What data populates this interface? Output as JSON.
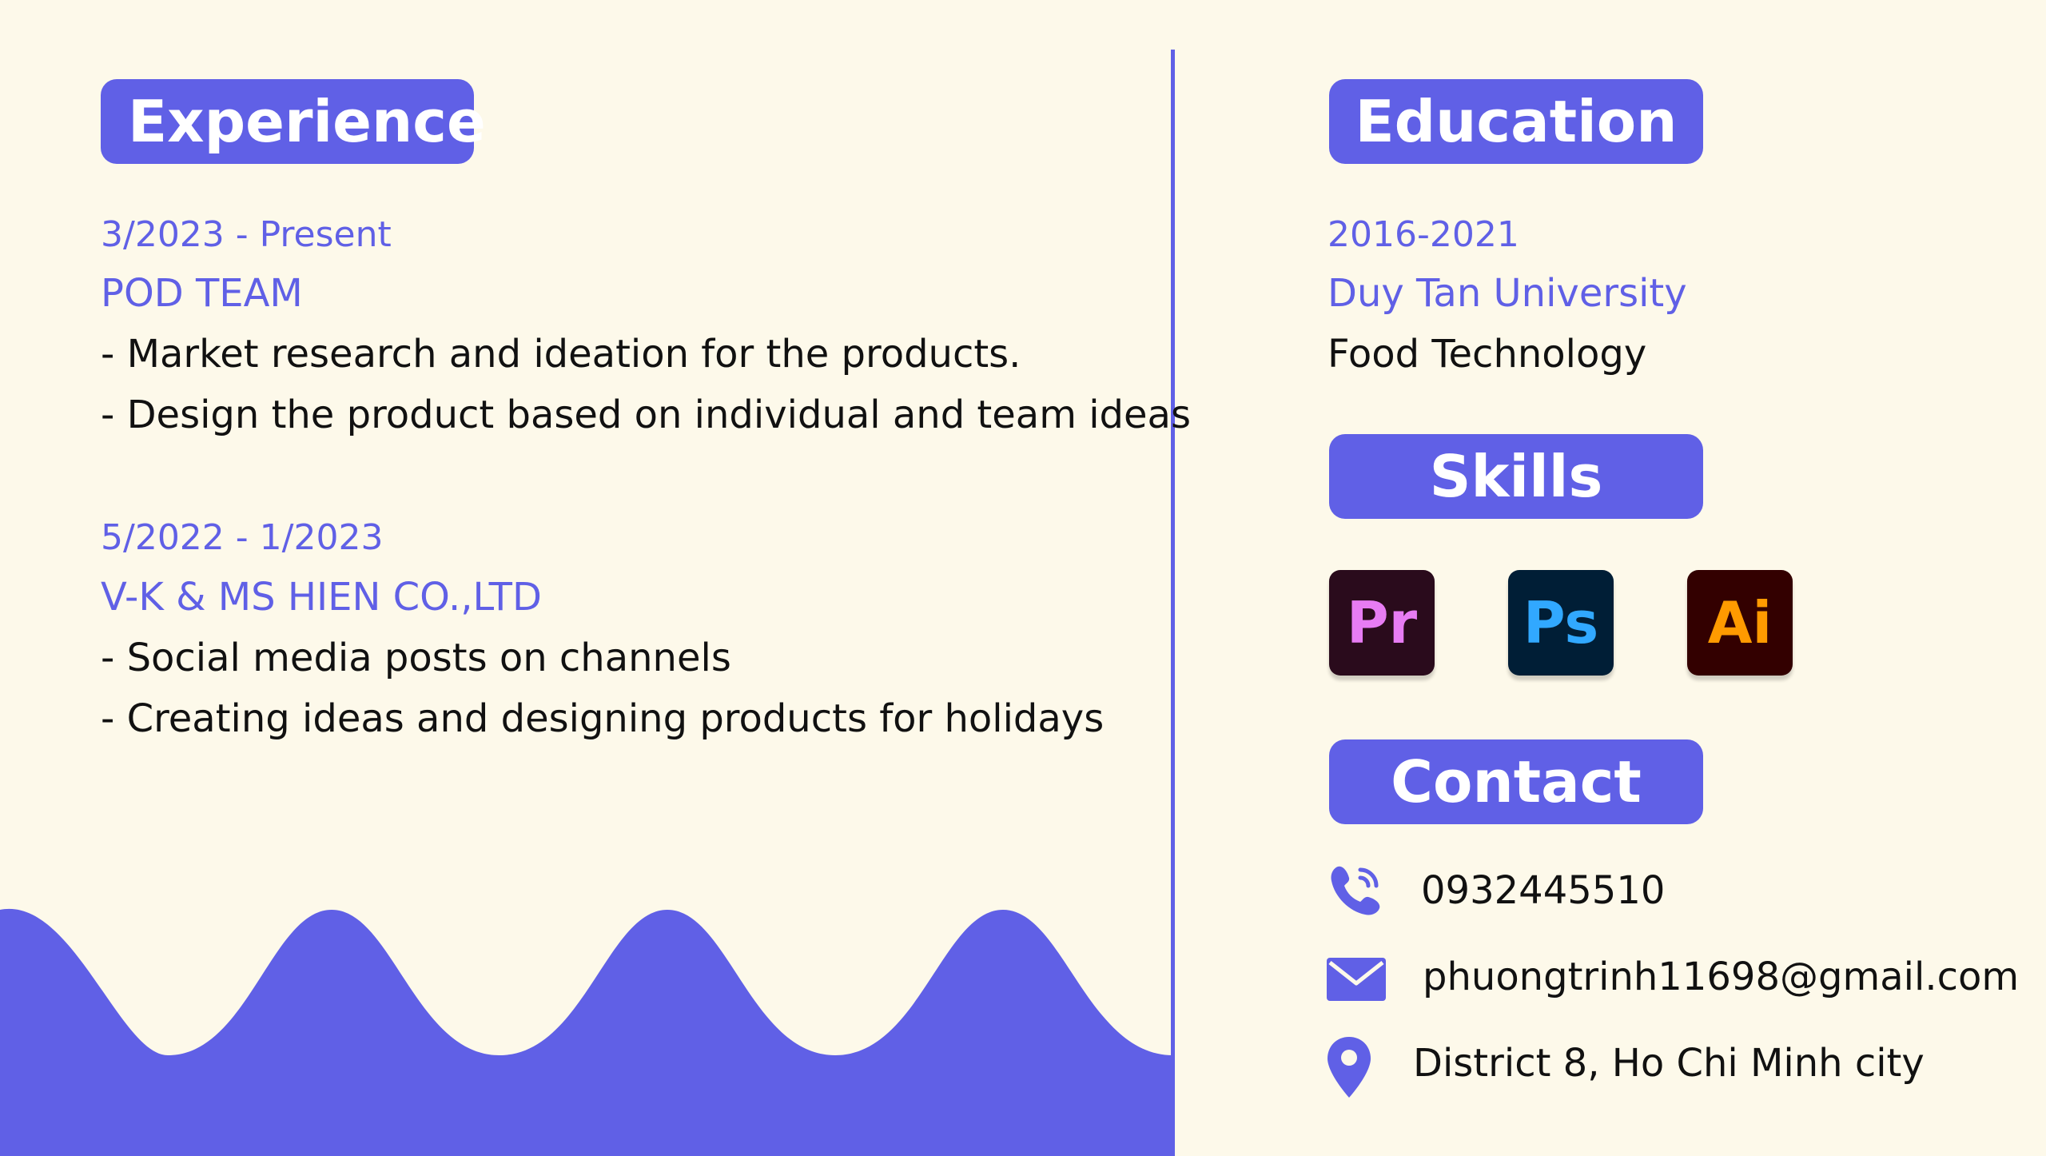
{
  "experience": {
    "title": "Experience",
    "jobs": [
      {
        "period": "3/2023 - Present",
        "company": "POD TEAM",
        "tasks": [
          "- Market research and ideation for the products.",
          "- Design the product based on individual and team ideas"
        ]
      },
      {
        "period": "5/2022 - 1/2023",
        "company": "V-K & MS HIEN CO.,LTD",
        "tasks": [
          "- Social media posts on channels",
          "- Creating ideas and designing products for holidays"
        ]
      }
    ]
  },
  "education": {
    "title": "Education",
    "years": "2016-2021",
    "school": "Duy Tan University",
    "major": "Food Technology"
  },
  "skills": {
    "title": "Skills",
    "apps": [
      {
        "label": "Pr",
        "icon": "premiere-pro-icon",
        "bg": "#2a0b1c",
        "fg": "#e77cf3"
      },
      {
        "label": "Ps",
        "icon": "photoshop-icon",
        "bg": "#001e36",
        "fg": "#31a8ff"
      },
      {
        "label": "Ai",
        "icon": "illustrator-icon",
        "bg": "#330000",
        "fg": "#ff9a00"
      }
    ]
  },
  "contact": {
    "title": "Contact",
    "phone": "0932445510",
    "email": "phuongtrinh11698@gmail.com",
    "address": "District 8, Ho Chi Minh city"
  },
  "colors": {
    "accent": "#6060e6",
    "background": "#fdf9ea",
    "text": "#111111"
  }
}
